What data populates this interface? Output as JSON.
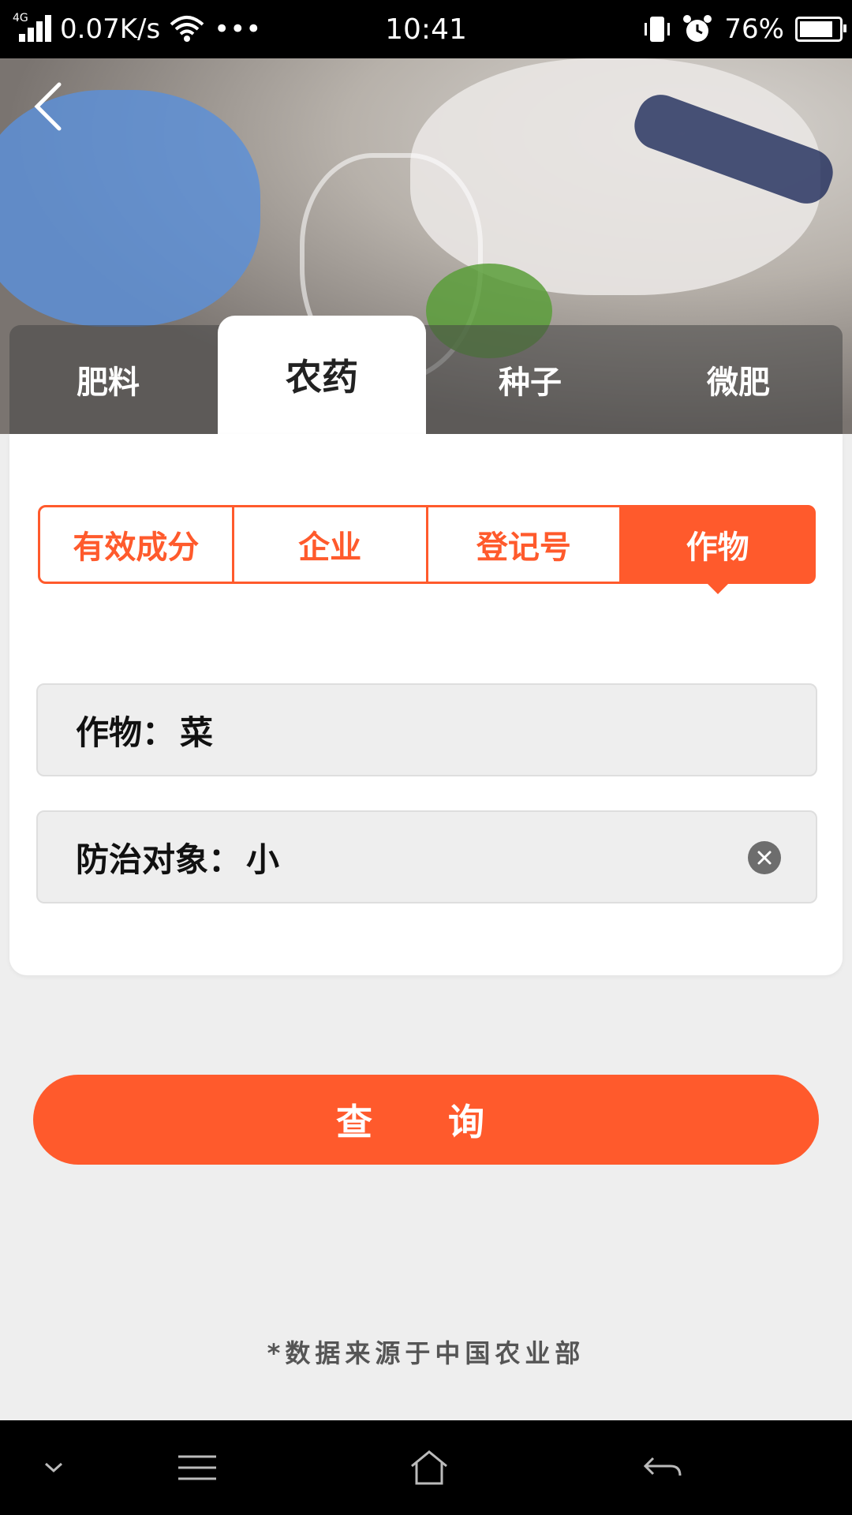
{
  "status_bar": {
    "network_type": "4G",
    "speed": "0.07K/s",
    "more": "•••",
    "time": "10:41",
    "battery": "76%"
  },
  "category_tabs": [
    {
      "label": "肥料"
    },
    {
      "label": "农药"
    },
    {
      "label": "种子"
    },
    {
      "label": "微肥"
    }
  ],
  "category_tabs_active_index": 1,
  "search_type_tabs": [
    {
      "label": "有效成分"
    },
    {
      "label": "企业"
    },
    {
      "label": "登记号"
    },
    {
      "label": "作物"
    }
  ],
  "search_type_active_index": 3,
  "fields": {
    "crop_label": "作物：",
    "crop_value": "菜",
    "target_label": "防治对象：",
    "target_value": "小"
  },
  "query_button": "查 询",
  "footnote": "*数据来源于中国农业部",
  "colors": {
    "accent": "#ff5a2c",
    "background": "#eeeeee"
  }
}
